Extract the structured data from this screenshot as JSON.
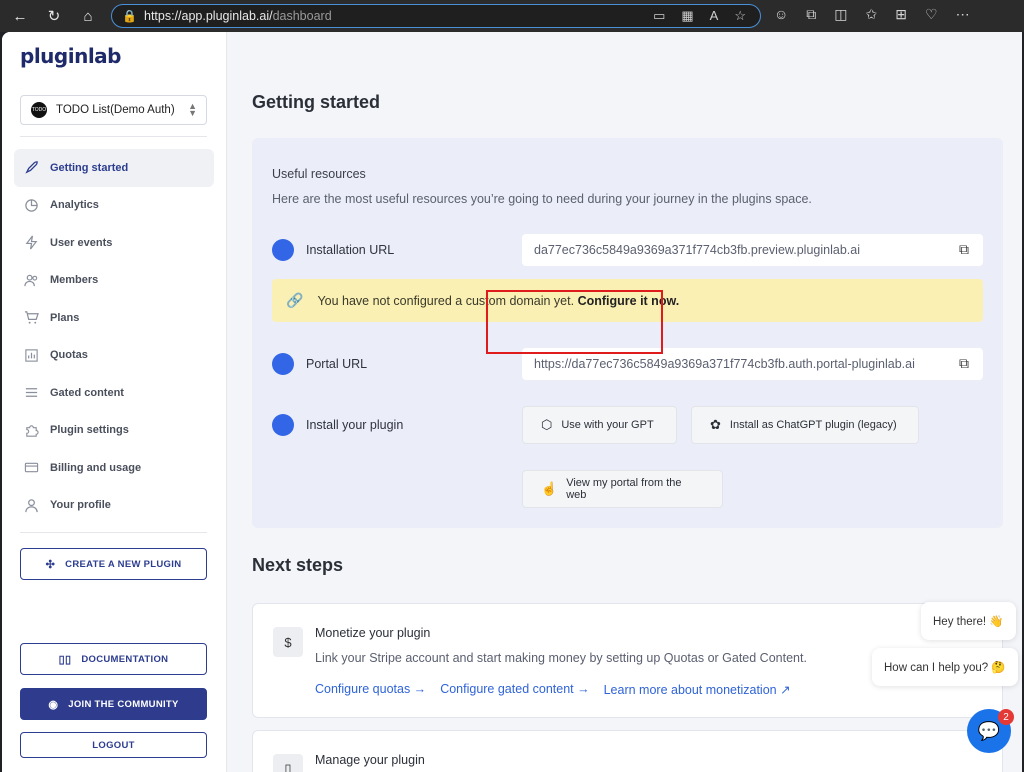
{
  "browser": {
    "url_host": "https://app.pluginlab.ai/",
    "url_path": "dashboard"
  },
  "sidebar": {
    "logo": "pluginlab",
    "project": {
      "name": "TODO List(Demo Auth)",
      "avatar_text": "TODO"
    },
    "items": [
      {
        "label": "Getting started",
        "icon": "rocket-icon",
        "active": true
      },
      {
        "label": "Analytics",
        "icon": "pie-chart-icon"
      },
      {
        "label": "User events",
        "icon": "bolt-icon"
      },
      {
        "label": "Members",
        "icon": "users-icon"
      },
      {
        "label": "Plans",
        "icon": "cart-icon"
      },
      {
        "label": "Quotas",
        "icon": "bar-chart-icon"
      },
      {
        "label": "Gated content",
        "icon": "list-icon"
      },
      {
        "label": "Plugin settings",
        "icon": "puzzle-icon"
      },
      {
        "label": "Billing and usage",
        "icon": "credit-card-icon"
      },
      {
        "label": "Your profile",
        "icon": "user-icon"
      }
    ],
    "create_plugin": "CREATE A NEW PLUGIN",
    "documentation": "DOCUMENTATION",
    "join_community": "JOIN THE COMMUNITY",
    "logout": "LOGOUT"
  },
  "main": {
    "title": "Getting started",
    "resources": {
      "title": "Useful resources",
      "subtitle": "Here are the most useful resources you’re going to need during your journey in the plugins space.",
      "installation_label": "Installation URL",
      "installation_url": "da77ec736c5849a9369a371f774cb3fb.preview.pluginlab.ai",
      "banner_text": "You have not configured a custom domain yet.",
      "banner_link": "Configure it now.",
      "portal_label": "Portal URL",
      "portal_url": "https://da77ec736c5849a9369a371f774cb3fb.auth.portal-pluginlab.ai",
      "install_label": "Install your plugin",
      "use_gpt": "Use with your GPT",
      "install_legacy": "Install as ChatGPT plugin (legacy)",
      "view_portal": "View my portal from the web"
    },
    "next_steps": {
      "title": "Next steps",
      "monetize": {
        "title": "Monetize your plugin",
        "desc": "Link your Stripe account and start making money by setting up Quotas or Gated Content.",
        "links": [
          "Configure quotas →",
          "Configure gated content →",
          "Learn more about monetization"
        ]
      },
      "manage": {
        "title": "Manage your plugin"
      }
    }
  },
  "chat": {
    "greeting": "Hey there! 👋",
    "question": "How can I help you? 🤔",
    "badge": "2"
  },
  "colors": {
    "accent": "#2c3d8f",
    "dot": "#3366e6",
    "link": "#2f63d8",
    "highlight": "#e01b1b"
  }
}
